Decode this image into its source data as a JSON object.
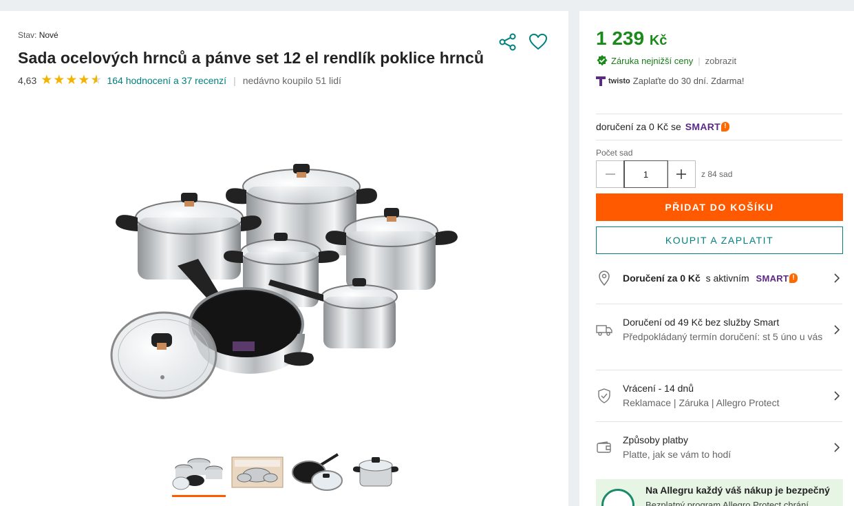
{
  "product": {
    "condition_label": "Stav:",
    "condition_value": "Nové",
    "title": "Sada ocelových hrnců a pánve set 12 el rendlík poklice hrnců",
    "rating": "4,63",
    "rating_stars": 4.63,
    "reviews_link": "164 hodnocení a 37 recenzí",
    "bought_recently": "nedávno koupilo 51 lidí"
  },
  "icons": {
    "share": "share-icon",
    "favorite": "heart-icon"
  },
  "gallery": {
    "thumbnail_count": 4,
    "active_thumbnail": 0
  },
  "purchase": {
    "price": "1 239",
    "currency": "Kč",
    "price_color": "#1a8a1a",
    "guarantee": "Záruka nejnižší ceny",
    "show_link": "zobrazit",
    "twisto_logo": "twisto",
    "twisto_text": "Zaplaťte do 30 dní. Zdarma!",
    "smart_delivery": "doručení za 0 Kč se",
    "smart_logo": "SMART",
    "quantity_label": "Počet sad",
    "quantity_value": "1",
    "quantity_max": "z 84 sad",
    "add_to_cart": "PŘIDAT DO KOŠÍKU",
    "add_to_cart_color": "#ff5a00",
    "buy_now": "KOUPIT A ZAPLATIT",
    "accent_color": "#00807e"
  },
  "info_rows": {
    "delivery_smart_bold": "Doručení za 0 Kč",
    "delivery_smart_rest": "s aktivním",
    "delivery_smart_logo": "SMART",
    "delivery_standard_title": "Doručení od 49 Kč bez služby Smart",
    "delivery_standard_sub": "Předpokládaný termín doručení: st 5 úno u vás",
    "returns_title": "Vrácení - 14 dnů",
    "returns_sub": "Reklamace | Záruka | Allegro Protect",
    "payment_title": "Způsoby platby",
    "payment_sub": "Platte, jak se vám to hodí"
  },
  "protect": {
    "title": "Na Allegru každý váš nákup je bezpečný",
    "subtitle": "Bezplatný program Allegro Protect chrání"
  }
}
